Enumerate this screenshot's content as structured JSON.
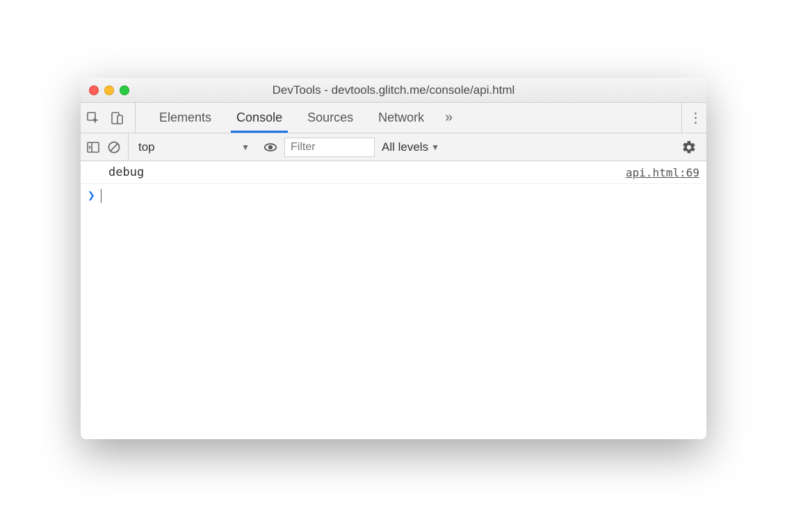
{
  "window": {
    "title": "DevTools - devtools.glitch.me/console/api.html"
  },
  "tabs": {
    "items": [
      "Elements",
      "Console",
      "Sources",
      "Network"
    ],
    "active_index": 1
  },
  "console_toolbar": {
    "context": "top",
    "filter_placeholder": "Filter",
    "levels_label": "All levels"
  },
  "console_log": {
    "message": "debug",
    "source": "api.html:69"
  },
  "prompt": {
    "marker": "❯"
  }
}
